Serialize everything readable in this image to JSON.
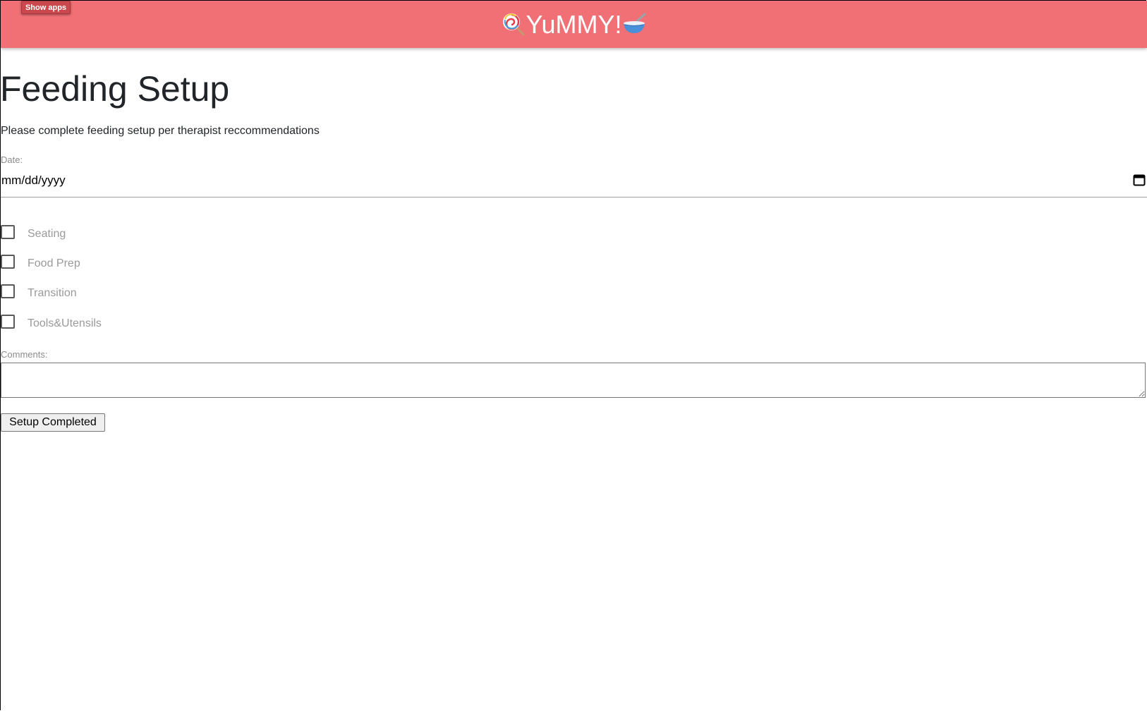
{
  "header": {
    "show_apps_label": "Show apps",
    "brand_name": "YuMMY!",
    "left_icon": "lollipop-icon",
    "right_icon": "bowl-with-spoon-icon",
    "bg_color": "#f07075"
  },
  "main": {
    "title": "Feeding Setup",
    "subtitle": "Please complete feeding setup per therapist reccommendations",
    "date_label": "Date:",
    "date_placeholder": "mm/dd/yyyy",
    "checklist": [
      {
        "label": "Seating",
        "checked": false
      },
      {
        "label": "Food Prep",
        "checked": false
      },
      {
        "label": "Transition",
        "checked": false
      },
      {
        "label": "Tools&Utensils",
        "checked": false
      }
    ],
    "comments_label": "Comments:",
    "comments_value": "",
    "submit_label": "Setup Completed"
  }
}
